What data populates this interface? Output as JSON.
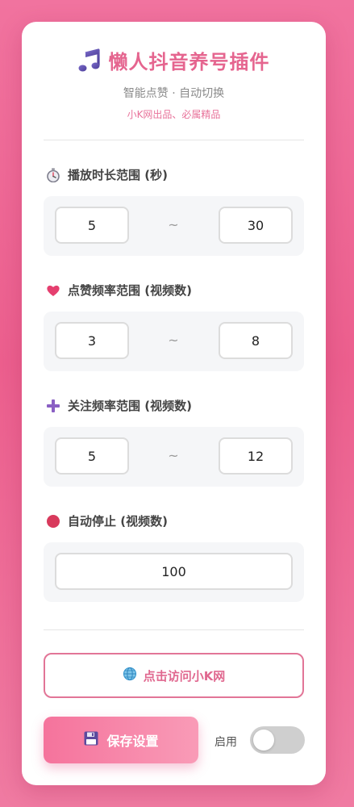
{
  "header": {
    "title": "懒人抖音养号插件",
    "subtitle": "智能点赞 · 自动切换",
    "tagline": "小K网出品、必属精品"
  },
  "sections": {
    "play_duration": {
      "label": "播放时长范围 (秒)",
      "min": "5",
      "max": "30",
      "icon": "stopwatch-icon"
    },
    "like_frequency": {
      "label": "点赞频率范围 (视频数)",
      "min": "3",
      "max": "8",
      "icon": "heart-icon"
    },
    "follow_frequency": {
      "label": "关注频率范围 (视频数)",
      "min": "5",
      "max": "12",
      "icon": "plus-icon"
    },
    "auto_stop": {
      "label": "自动停止 (视频数)",
      "value": "100",
      "icon": "red-circle-icon"
    }
  },
  "separator": "~",
  "buttons": {
    "visit_label": "点击访问小K网",
    "save_label": "保存设置"
  },
  "toggle": {
    "label": "启用",
    "enabled": false
  },
  "colors": {
    "accent": "#e5658f",
    "background": "#ec5f8e",
    "toggle_off": "#cfcfcf"
  }
}
